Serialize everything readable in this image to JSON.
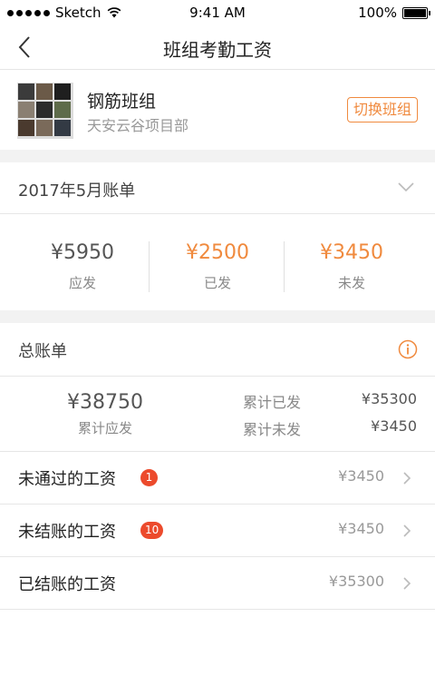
{
  "status_bar": {
    "carrier": "Sketch",
    "time": "9:41 AM",
    "battery": "100%"
  },
  "nav": {
    "title": "班组考勤工资",
    "back_icon": "chevron-left-icon"
  },
  "team": {
    "name": "钢筋班组",
    "project": "天安云谷项目部",
    "switch_label": "切换班组"
  },
  "month": {
    "label": "2017年5月账单",
    "stats": [
      {
        "value": "¥5950",
        "label": "应发"
      },
      {
        "value": "¥2500",
        "label": "已发"
      },
      {
        "value": "¥3450",
        "label": "未发"
      }
    ]
  },
  "total": {
    "title": "总账单",
    "main_value": "¥38750",
    "main_label": "累计应发",
    "paid_label": "累计已发",
    "paid_value": "¥35300",
    "unpaid_label": "累计未发",
    "unpaid_value": "¥3450"
  },
  "list": [
    {
      "label": "未通过的工资",
      "badge": "1",
      "amount": "¥3450"
    },
    {
      "label": "未结账的工资",
      "badge": "10",
      "amount": "¥3450"
    },
    {
      "label": "已结账的工资",
      "badge": "",
      "amount": "¥35300"
    }
  ],
  "colors": {
    "accent": "#f08a3e",
    "badge": "#ec4a2c"
  }
}
